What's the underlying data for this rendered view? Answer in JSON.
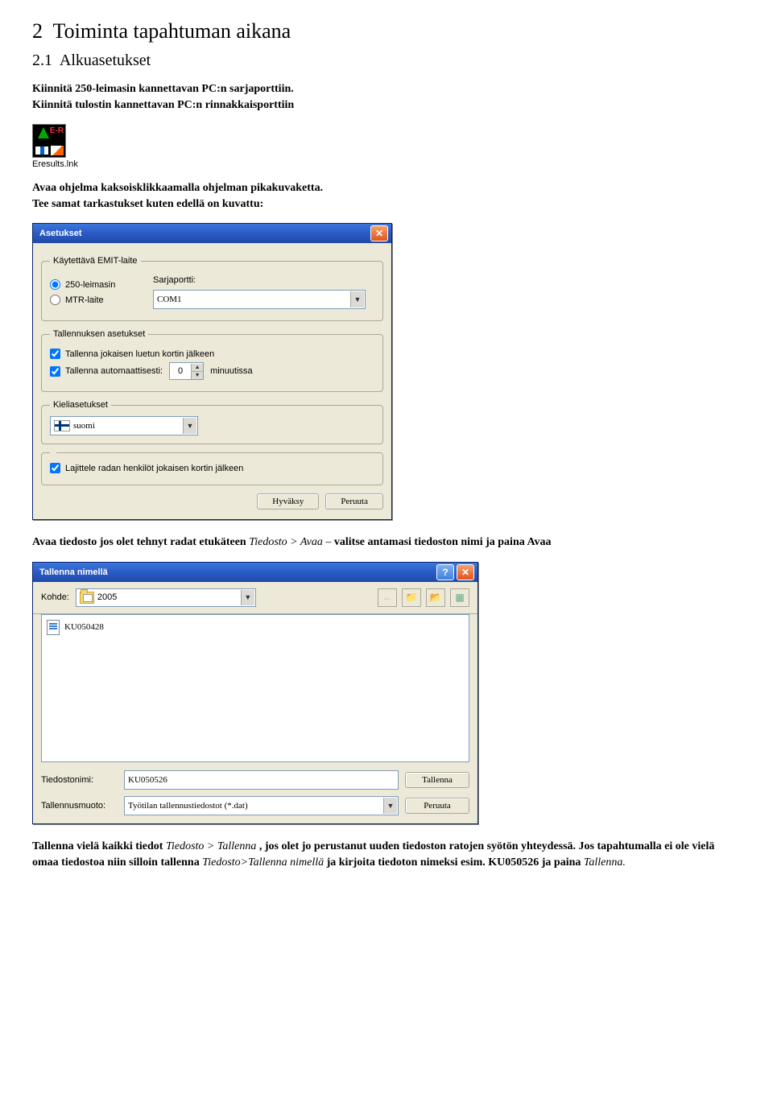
{
  "doc": {
    "heading_num": "2",
    "heading": "Toiminta tapahtuman aikana",
    "subheading_num": "2.1",
    "subheading": "Alkuasetukset",
    "p1a": "Kiinnitä 250-leimasin kannettavan PC:n sarjaporttiin.",
    "p1b": "Kiinnitä tulostin kannettavan PC:n rinnakkaisporttiin",
    "icon_caption": "Eresults.lnk",
    "p2a": "Avaa ohjelma kaksoisklikkaamalla ohjelman pikakuvaketta.",
    "p2b": "Tee samat tarkastukset kuten edellä on kuvattu:",
    "p3a": "Avaa tiedosto jos olet tehnyt radat etukäteen",
    "p3b": "Tiedosto > Avaa –",
    "p3c": "valitse antamasi tiedoston nimi ja paina Avaa",
    "p4a": "Tallenna vielä kaikki tiedot",
    "p4b": " Tiedosto > Tallenna",
    "p4c": ", jos olet jo perustanut uuden tiedoston ratojen syötön yhteydessä. Jos tapahtumalla ei ole vielä omaa tiedostoa niin silloin tallenna",
    "p4d": "Tiedosto>Tallenna nimellä",
    "p4e": " ja kirjoita tiedoton nimeksi esim. KU050526 ja paina",
    "p4f": " Tallenna."
  },
  "settings": {
    "title": "Asetukset",
    "group_emit": "Käytettävä EMIT-laite",
    "radio1": "250-leimasin",
    "radio2": "MTR-laite",
    "serial_label": "Sarjaportti:",
    "serial_value": "COM1",
    "group_save": "Tallennuksen asetukset",
    "chk1": "Tallenna jokaisen luetun kortin jälkeen",
    "chk2": "Tallenna automaattisesti:",
    "spin_value": "0",
    "spin_suffix": "minuutissa",
    "group_lang": "Kieliasetukset",
    "lang_value": "suomi",
    "chk_sort": "Lajittele radan henkilöt jokaisen kortin jälkeen",
    "btn_ok": "Hyväksy",
    "btn_cancel": "Peruuta"
  },
  "saveas": {
    "title": "Tallenna nimellä",
    "look_in_label": "Kohde:",
    "look_in_value": "2005",
    "file1": "KU050428",
    "filename_label": "Tiedostonimi:",
    "filename_value": "KU050526",
    "filetype_label": "Tallennusmuoto:",
    "filetype_value": "Työtilan tallennustiedostot (*.dat)",
    "btn_save": "Tallenna",
    "btn_cancel": "Peruuta"
  }
}
